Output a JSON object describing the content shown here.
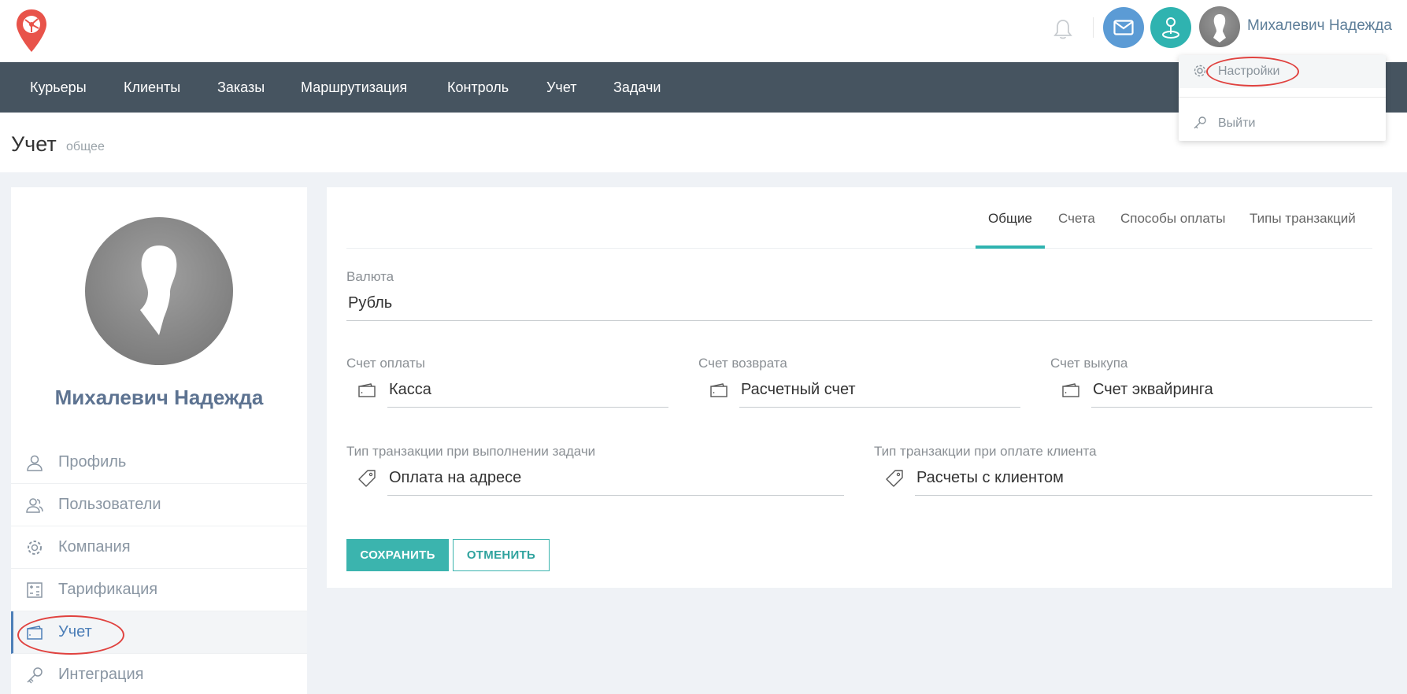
{
  "header": {
    "user_name": "Михалевич Надежда"
  },
  "nav": {
    "items": [
      "Курьеры",
      "Клиенты",
      "Заказы",
      "Маршрутизация",
      "Контроль",
      "Учет",
      "Задачи"
    ]
  },
  "dropdown": {
    "settings_label": "Настройки",
    "logout_label": "Выйти"
  },
  "page": {
    "title": "Учет",
    "subtitle": "общее"
  },
  "sidebar": {
    "user_name": "Михалевич Надежда",
    "items": [
      {
        "label": "Профиль",
        "icon": "user-icon"
      },
      {
        "label": "Пользователи",
        "icon": "users-icon"
      },
      {
        "label": "Компания",
        "icon": "gear-icon"
      },
      {
        "label": "Тарификация",
        "icon": "calculator-icon"
      },
      {
        "label": "Учет",
        "icon": "wallet-icon",
        "active": true
      },
      {
        "label": "Интеграция",
        "icon": "key-icon"
      }
    ]
  },
  "tabs": [
    "Общие",
    "Счета",
    "Способы оплаты",
    "Типы транзакций"
  ],
  "form": {
    "currency_label": "Валюта",
    "currency_value": "Рубль",
    "payment_account_label": "Счет оплаты",
    "payment_account_value": "Касса",
    "refund_account_label": "Счет возврата",
    "refund_account_value": "Расчетный счет",
    "buyout_account_label": "Счет выкупа",
    "buyout_account_value": "Счет эквайринга",
    "task_tx_label": "Тип транзакции при выполнении задачи",
    "task_tx_value": "Оплата на адресе",
    "client_tx_label": "Тип транзакции при оплате клиента",
    "client_tx_value": "Расчеты с клиентом",
    "save_label": "СОХРАНИТЬ",
    "cancel_label": "ОТМЕНИТЬ"
  },
  "colors": {
    "accent": "#2fb3b0",
    "nav_bg": "#465460",
    "highlight": "#e0423f",
    "link_blue": "#4d7fb8"
  }
}
